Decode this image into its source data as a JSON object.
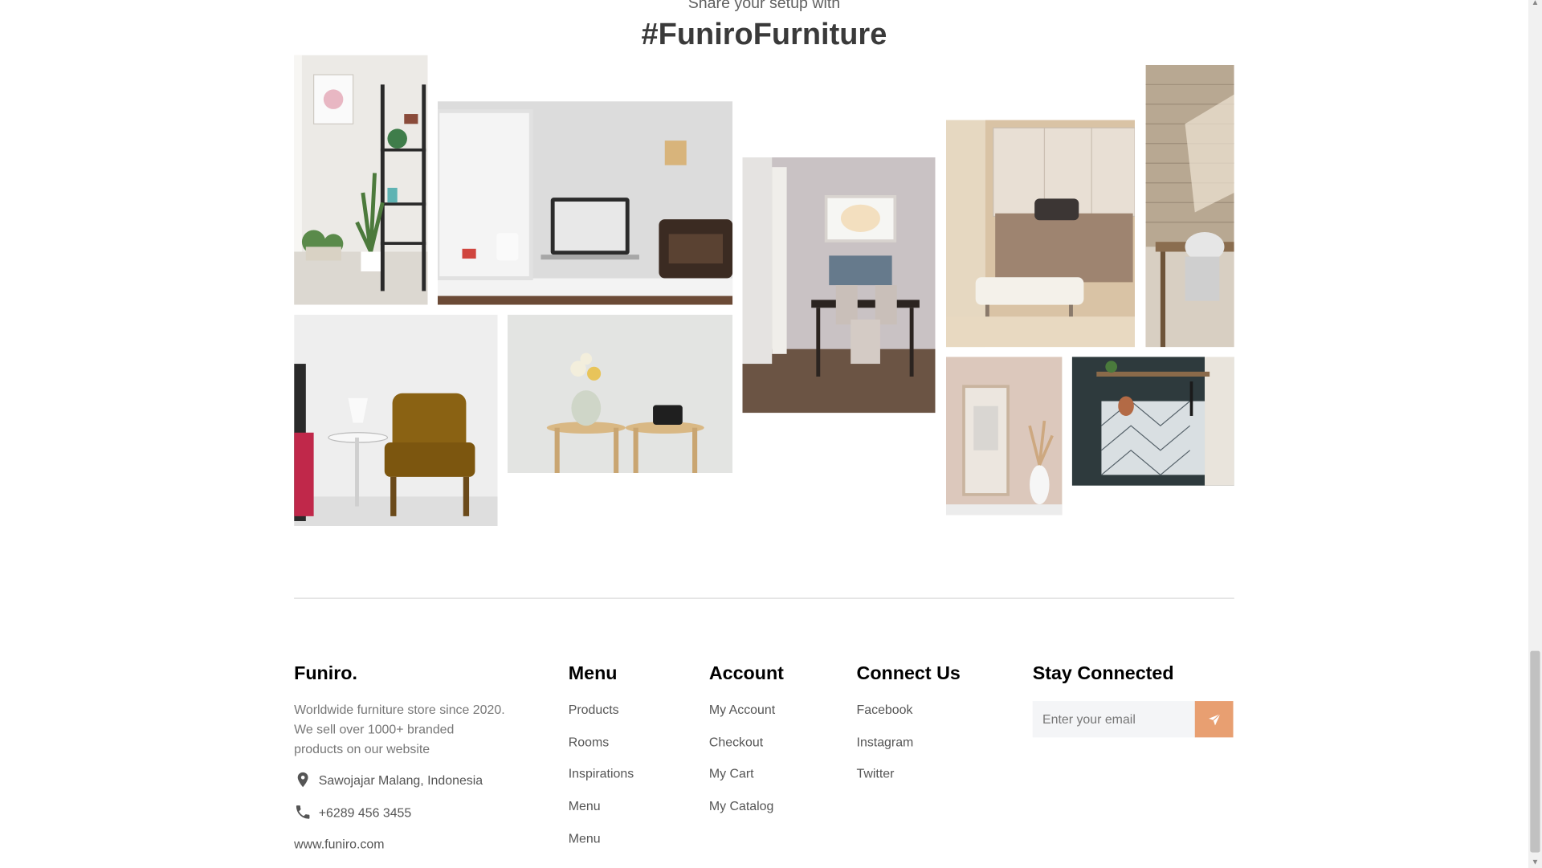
{
  "gallery": {
    "subtitle": "Share your setup with",
    "title": "#FuniroFurniture",
    "photos": [
      {
        "name": "photo-shelf-plants"
      },
      {
        "name": "photo-laptop-desk"
      },
      {
        "name": "photo-dining-room"
      },
      {
        "name": "photo-bedroom"
      },
      {
        "name": "photo-brick-dining"
      },
      {
        "name": "photo-armchair"
      },
      {
        "name": "photo-stools-vase"
      },
      {
        "name": "photo-frame-vase"
      },
      {
        "name": "photo-kitchen-shelf"
      }
    ]
  },
  "footer": {
    "brand": "Funiro.",
    "description": "Worldwide furniture store since 2020. We sell over 1000+ branded products on our website",
    "address": "Sawojajar Malang, Indonesia",
    "phone": "+6289 456 3455",
    "website": "www.funiro.com",
    "menu": {
      "title": "Menu",
      "items": [
        "Products",
        "Rooms",
        "Inspirations",
        "Menu",
        "Menu"
      ]
    },
    "account": {
      "title": "Account",
      "items": [
        "My Account",
        "Checkout",
        "My Cart",
        "My Catalog"
      ]
    },
    "connect": {
      "title": "Connect Us",
      "items": [
        "Facebook",
        "Instagram",
        "Twitter"
      ]
    },
    "newsletter": {
      "title": "Stay Connected",
      "placeholder": "Enter your email"
    }
  },
  "colors": {
    "accent": "#e89f71",
    "text_dark": "#3a3a3a",
    "muted": "#777777"
  },
  "icons": [
    "location-pin-icon",
    "phone-icon",
    "send-icon"
  ]
}
